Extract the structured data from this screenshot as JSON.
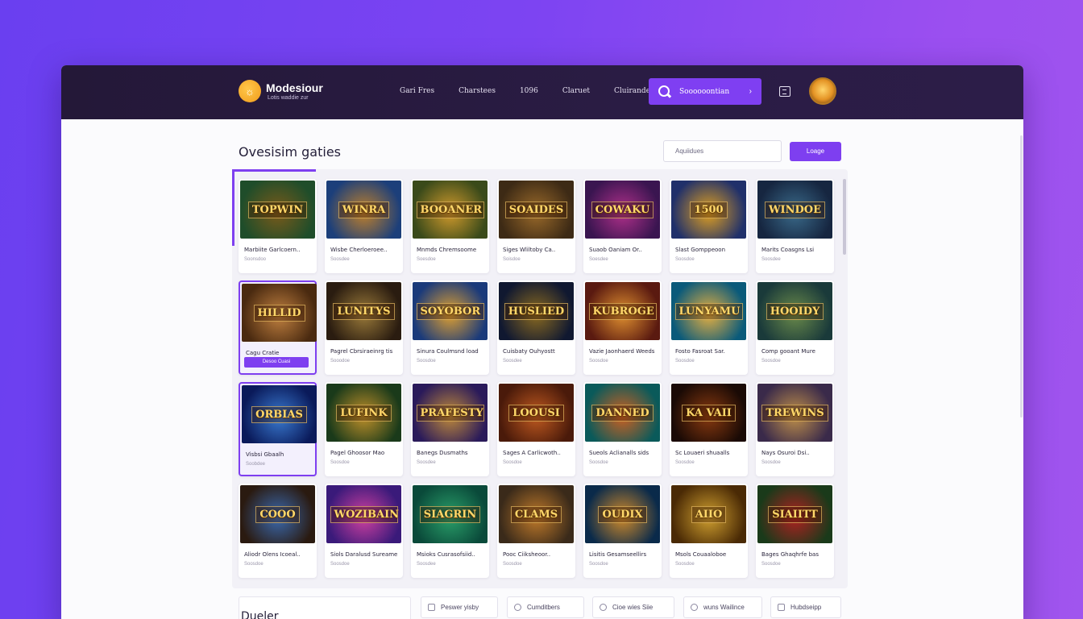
{
  "header": {
    "brand_name": "Modesiour",
    "brand_tagline": "Lotis waddie zur",
    "nav": [
      "Gari Fres",
      "Charstees",
      "1096",
      "Claruet",
      "Cluirandes"
    ],
    "search_label": "Soooooontian",
    "search_arrow": "›"
  },
  "main": {
    "title": "Ovesisim gaties",
    "filter_placeholder": "Aquiidues",
    "login_label": "Loage",
    "selected_button": "Desoo Cuasi"
  },
  "games": [
    {
      "banner": "TOPWIN",
      "title": "Marbiite Garlcoern..",
      "sub": "Soonsdoo",
      "colors": [
        "#1f4d2a",
        "#7a5a1a"
      ]
    },
    {
      "banner": "WINRA",
      "title": "Wisbe Cherloeroee..",
      "sub": "Soosdee",
      "colors": [
        "#1c3f7a",
        "#c0802a"
      ]
    },
    {
      "banner": "BOOANER",
      "title": "Mnmds Chremsoome",
      "sub": "Soesdoe",
      "colors": [
        "#3a4a1a",
        "#d19a2c"
      ]
    },
    {
      "banner": "SOAIDES",
      "title": "Siges Wliltoby Ca..",
      "sub": "Soisdoe",
      "colors": [
        "#3d2a15",
        "#9a6a2a"
      ]
    },
    {
      "banner": "COWAKU",
      "title": "Suaob Oaniam Or..",
      "sub": "Soesdee",
      "colors": [
        "#3a1550",
        "#b0308a"
      ]
    },
    {
      "banner": "1500",
      "title": "Slast Gomppeoon",
      "sub": "Soosdoe",
      "colors": [
        "#20306a",
        "#e0a020"
      ]
    },
    {
      "banner": "WINDOE",
      "title": "Marits Coasgns Lsi",
      "sub": "Soosdee",
      "colors": [
        "#162640",
        "#3a6a8a"
      ]
    },
    {
      "banner": "HILLID",
      "title": "Cagu Cratie",
      "sub": "",
      "colors": [
        "#4a2a10",
        "#c08040"
      ],
      "selected": true
    },
    {
      "banner": "LUNITYS",
      "title": "Pagrel Cbrsiraeinrg tis",
      "sub": "Sooodoe",
      "colors": [
        "#2a1c10",
        "#9a7a3a"
      ]
    },
    {
      "banner": "SOYOBOR",
      "title": "Sinura Coulmsnd load",
      "sub": "Soosdoe",
      "colors": [
        "#1a3a7a",
        "#e0a030"
      ]
    },
    {
      "banner": "HUSLIED",
      "title": "Cuisbaty Ouhyostt",
      "sub": "Soosdee",
      "colors": [
        "#101830",
        "#8a6a20"
      ]
    },
    {
      "banner": "KUBROGE",
      "title": "Vazie Jaonhaerd Weeds",
      "sub": "Soosdoe",
      "colors": [
        "#5a1a10",
        "#e09030"
      ]
    },
    {
      "banner": "LUNYAMU",
      "title": "Fosto Fasroat Sar.",
      "sub": "Soosdoe",
      "colors": [
        "#0a5a7a",
        "#e8b040"
      ]
    },
    {
      "banner": "HOOIDY",
      "title": "Comp gooant Mure",
      "sub": "Soosdoe",
      "colors": [
        "#1a3a3a",
        "#6a8a4a"
      ]
    },
    {
      "banner": "ORBIAS",
      "title": "Visbsi Gbaalh",
      "sub": "Soobdee",
      "colors": [
        "#0a1a5a",
        "#3a7ad0"
      ],
      "selected": true
    },
    {
      "banner": "LUFINK",
      "title": "Pagel Ghoosor Mao",
      "sub": "Soosdoe",
      "colors": [
        "#1a3a1a",
        "#c0902a"
      ]
    },
    {
      "banner": "PRAFESTY",
      "title": "Banegs Dusmaths",
      "sub": "Soosdee",
      "colors": [
        "#2a1a5a",
        "#c08a3a"
      ]
    },
    {
      "banner": "LOOUSI",
      "title": "Sages A Carlicwoth..",
      "sub": "Soosdoe",
      "colors": [
        "#4a1a0a",
        "#c05a20"
      ]
    },
    {
      "banner": "DANNED",
      "title": "Sueols Aclianalls sids",
      "sub": "Soosdoe",
      "colors": [
        "#0a5a5a",
        "#d06020"
      ]
    },
    {
      "banner": "KA VAII",
      "title": "Sc Louaeri shuaalls",
      "sub": "Soosdoe",
      "colors": [
        "#1a0a05",
        "#8a3a10"
      ]
    },
    {
      "banner": "TREWINS",
      "title": "Nays Osuroi Dsi..",
      "sub": "Soosdoe",
      "colors": [
        "#3a2a4a",
        "#c0904a"
      ]
    },
    {
      "banner": "COOO",
      "title": "Aliodr Olens Icoeal..",
      "sub": "Soosdoe",
      "colors": [
        "#2a1a10",
        "#3a6ab0"
      ]
    },
    {
      "banner": "WOZIBAIN",
      "title": "Siols Daralusd Sureame",
      "sub": "Soosdoe",
      "colors": [
        "#3a1a7a",
        "#d040a0"
      ]
    },
    {
      "banner": "SIAGRIN",
      "title": "Msioks Cusrasofsiid..",
      "sub": "Soosdee",
      "colors": [
        "#0a4a3a",
        "#2aa06a"
      ]
    },
    {
      "banner": "CLAMS",
      "title": "Pooc Ciiksheoor..",
      "sub": "Soosdoe",
      "colors": [
        "#3a2a1a",
        "#c07a2a"
      ]
    },
    {
      "banner": "OUDIX",
      "title": "Lisitis Gesamseellirs",
      "sub": "Soosdoe",
      "colors": [
        "#0a2a4a",
        "#d08a2a"
      ]
    },
    {
      "banner": "AIIO",
      "title": "Msols Couaaloboe",
      "sub": "Soosdoe",
      "colors": [
        "#4a2a05",
        "#d0a030"
      ]
    },
    {
      "banner": "SIAIITT",
      "title": "Bages Ghaqhrfe bas",
      "sub": "Soosdoe",
      "colors": [
        "#1a3a1a",
        "#b02020"
      ]
    }
  ],
  "footer": {
    "label": "Dueler",
    "chips": [
      "Peswer yisby",
      "Cumditbers",
      "Cioe wies Siie",
      "wuns Wailince",
      "Hubdseipp"
    ]
  }
}
